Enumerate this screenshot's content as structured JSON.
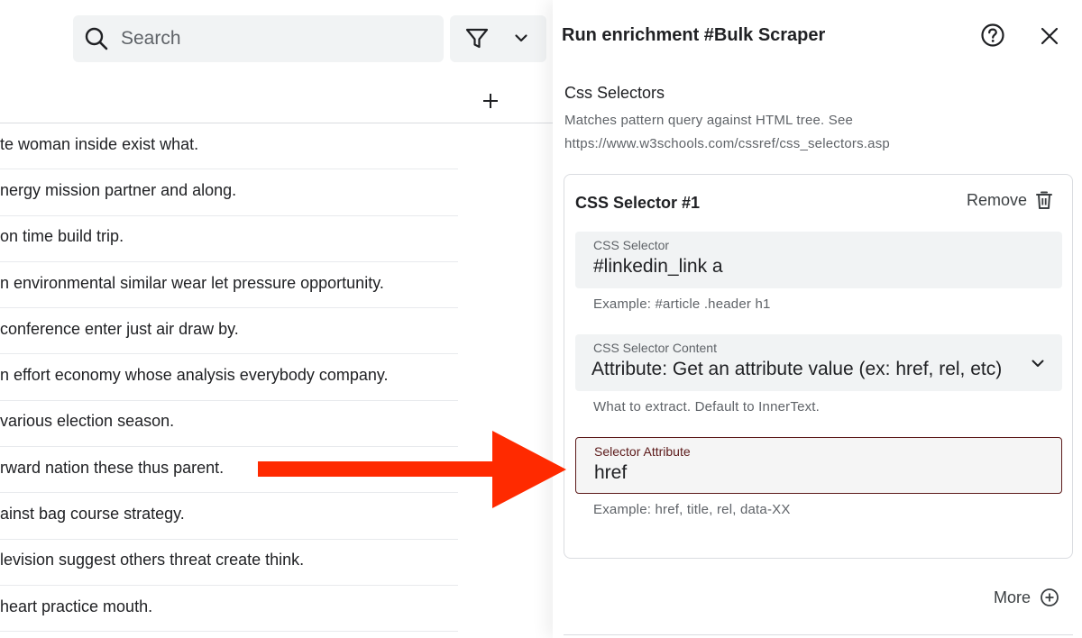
{
  "search": {
    "placeholder": "Search",
    "value": ""
  },
  "table": {
    "rows": [
      "te woman inside exist what.",
      "nergy mission partner and along.",
      "on time build trip.",
      "n environmental similar wear let pressure opportunity.",
      "conference enter just air draw by.",
      "n effort economy whose analysis everybody company.",
      " various election season.",
      "rward nation these thus parent.",
      "ainst bag course strategy.",
      "levision suggest others threat create think.",
      " heart practice mouth."
    ]
  },
  "panel": {
    "title": "Run enrichment #Bulk Scraper",
    "section_title": "Css Selectors",
    "section_desc_line1": "Matches pattern query against HTML tree. See",
    "section_desc_line2": "https://www.w3schools.com/cssref/css_selectors.asp",
    "card": {
      "title": "CSS Selector #1",
      "remove_label": "Remove",
      "selector_label": "CSS Selector",
      "selector_value": "#linkedin_link a",
      "selector_helper": "Example: #article .header h1",
      "content_label": "CSS Selector Content",
      "content_value": "Attribute: Get an attribute value (ex: href, rel, etc)",
      "content_helper": "What to extract. Default to InnerText.",
      "attribute_label": "Selector Attribute",
      "attribute_value": "href",
      "attribute_helper": "Example: href, title, rel, data-XX"
    },
    "more_label": "More"
  },
  "colors": {
    "annotation_arrow": "#ff2a00",
    "active_field_border": "#5c1a1a",
    "field_bg": "#f1f3f4"
  }
}
